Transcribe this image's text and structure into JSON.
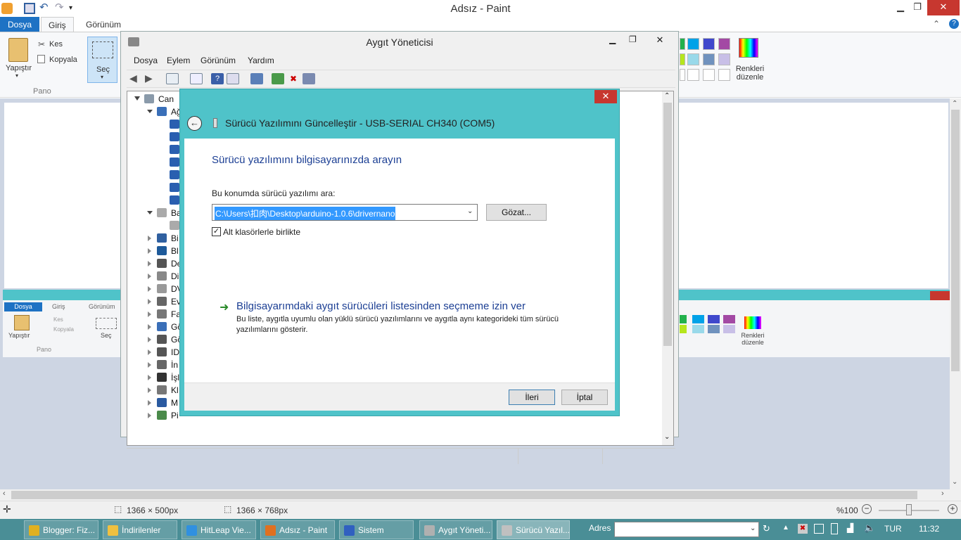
{
  "paint": {
    "title": "Adsız - Paint",
    "tabs": {
      "file": "Dosya",
      "home": "Giriş",
      "view": "Görünüm"
    },
    "clipboard": {
      "paste": "Yapıştır",
      "cut": "Kes",
      "copy": "Kopyala",
      "group": "Pano"
    },
    "select": "Seç",
    "edit_colors": "Renkleri düzenle",
    "status": {
      "canvas_size": "1366 × 500px",
      "selection_size": "1366 × 768px",
      "zoom": "%100"
    }
  },
  "mini": {
    "tabs": {
      "file": "Dosya",
      "home": "Giriş",
      "view": "Görünüm"
    },
    "paste": "Yapıştır",
    "cut": "Kes",
    "copy": "Kopyala",
    "group": "Pano",
    "select": "Seç",
    "edit_colors": "Renkleri düzenle"
  },
  "device_manager": {
    "title": "Aygıt Yöneticisi",
    "menu": {
      "file": "Dosya",
      "action": "Eylem",
      "view": "Görünüm",
      "help": "Yardım"
    },
    "tree": {
      "root": "Can",
      "items": [
        "Ağ",
        "Ba",
        "Bi",
        "Bl",
        "De",
        "Di",
        "DV",
        "Ev",
        "Fa",
        "Gö",
        "Gö",
        "ID",
        "İn",
        "İşl",
        "Kl",
        "M",
        "Pi"
      ]
    }
  },
  "dialog": {
    "title": "Sürücü Yazılımını Güncelleştir - USB-SERIAL CH340 (COM5)",
    "heading": "Sürücü yazılımını bilgisayarınızda arayın",
    "search_label": "Bu konumda sürücü yazılımı ara:",
    "path_value": "C:\\Users\\扣肉\\Desktop\\arduino-1.0.6\\drivernano",
    "browse": "Gözat...",
    "subfolders": "Alt klasörlerle birlikte",
    "pick_title": "Bilgisayarımdaki aygıt sürücüleri listesinden seçmeme izin ver",
    "pick_desc": "Bu liste, aygıtla uyumlu olan yüklü sürücü yazılımlarını ve aygıtla aynı kategorideki tüm sürücü yazılımlarını gösterir.",
    "next": "İleri",
    "cancel": "İptal"
  },
  "taskbar": {
    "items": [
      {
        "label": "Blogger: Fiz...",
        "icon": "chrome-icon",
        "color": "#e0b020"
      },
      {
        "label": "İndirilenler",
        "icon": "folder-icon",
        "color": "#f0c040"
      },
      {
        "label": "HitLeap Vie...",
        "icon": "hitleap-icon",
        "color": "#3090e0"
      },
      {
        "label": "Adsız - Paint",
        "icon": "paint-icon",
        "color": "#e07020"
      },
      {
        "label": "Sistem",
        "icon": "system-icon",
        "color": "#3060c0"
      },
      {
        "label": "Aygıt Yöneti...",
        "icon": "devmgr-icon",
        "color": "#b0b0b0"
      },
      {
        "label": "Sürücü Yazıl...",
        "icon": "driver-icon",
        "color": "#c0c0c0"
      }
    ],
    "address_label": "Adres",
    "lang": "TUR",
    "time": "11:32"
  }
}
